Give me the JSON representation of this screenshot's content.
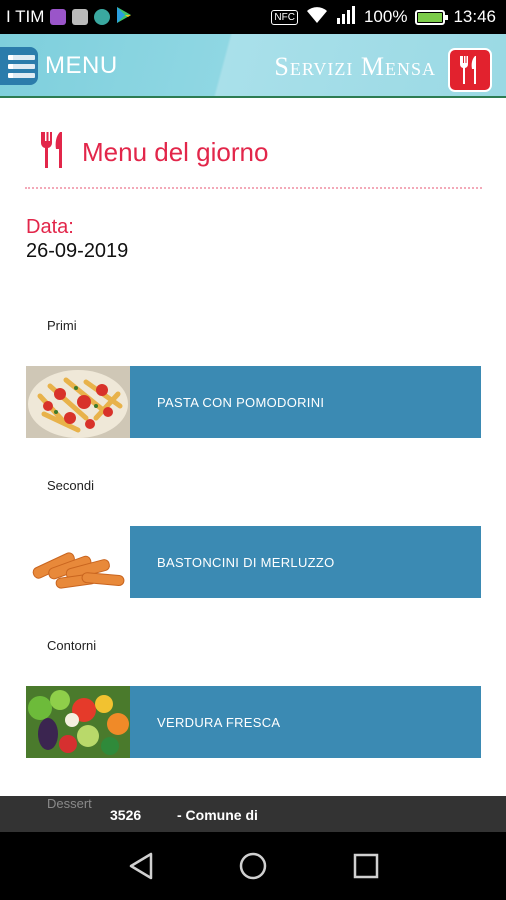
{
  "status_bar": {
    "carrier": "I TIM",
    "nfc": "NFC",
    "battery": "100%",
    "battery_level": 1.0,
    "time": "13:46",
    "icons": [
      "app-icon-purple",
      "app-icon-gray",
      "app-icon-teal",
      "play-store-icon",
      "nfc-icon",
      "wifi-icon",
      "signal-icon",
      "battery-icon"
    ]
  },
  "app_bar": {
    "menu_label": "MENU",
    "title": "Servizi Mensa",
    "colors": {
      "bar": "#8fd7e3",
      "menu_icon": "#2b7cab",
      "logo": "#e2222e"
    }
  },
  "page": {
    "heading": "Menu del giorno",
    "date_label": "Data:",
    "date_value": "26-09-2019",
    "accent": "#e2264a"
  },
  "menu": [
    {
      "category": "Primi",
      "dish": "PASTA CON POMODORINI",
      "image": "pasta-image"
    },
    {
      "category": "Secondi",
      "dish": "BASTONCINI DI MERLUZZO",
      "image": "fish-sticks-image"
    },
    {
      "category": "Contorni",
      "dish": "VERDURA FRESCA",
      "image": "vegetables-image"
    },
    {
      "category": "Dessert"
    }
  ],
  "row_color": "#3b8ab3",
  "banner": {
    "number": "3526",
    "text": "- Comune di"
  }
}
